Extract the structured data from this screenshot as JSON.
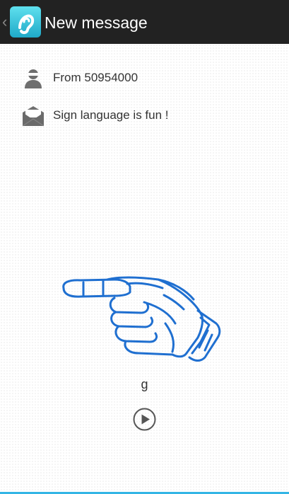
{
  "action_bar": {
    "title": "New message",
    "app_icon": "ear-icon",
    "up_icon": "chevron-left-icon",
    "background": "#222222",
    "accent": "#33b5e5"
  },
  "message": {
    "from_label": "From 50954000",
    "from_icon": "person-icon",
    "body": "Sign language is fun !",
    "body_icon": "envelope-icon"
  },
  "sign": {
    "image": "hand-sign-g-image",
    "letter": "g",
    "stroke_color": "#1f6fd0"
  },
  "controls": {
    "play_icon": "play-icon"
  }
}
